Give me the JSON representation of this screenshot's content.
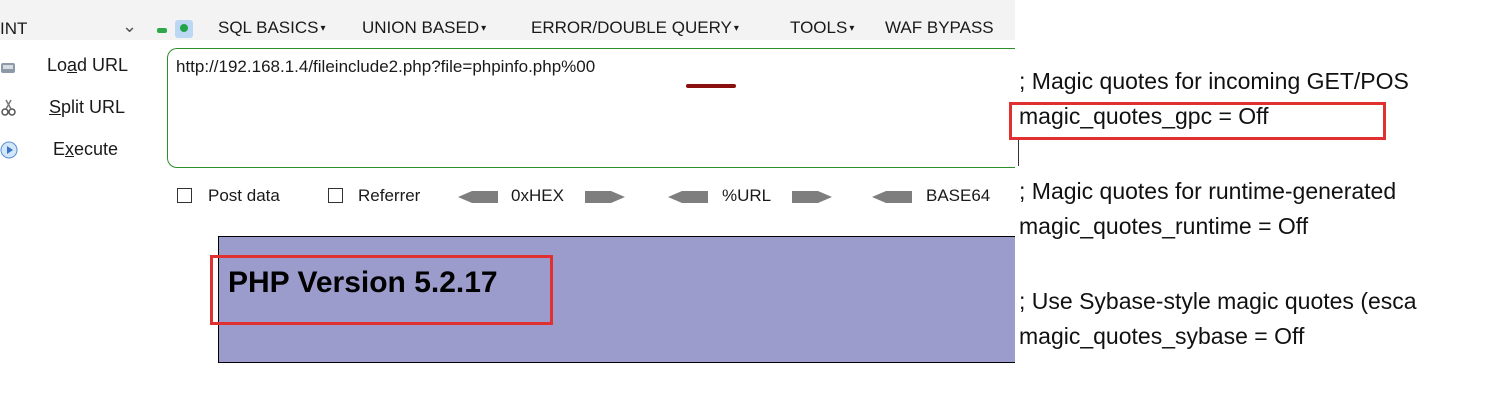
{
  "toolbar": {
    "selected": "INT",
    "menus": [
      "SQL BASICS",
      "UNION BASED",
      "ERROR/DOUBLE QUERY",
      "TOOLS",
      "WAF BYPASS"
    ],
    "menu_arrow": "▾"
  },
  "side_actions": [
    {
      "label": "Load URL",
      "accel": "a",
      "icon": "load-url-icon"
    },
    {
      "label": "Split URL",
      "accel": "S",
      "icon": "split-url-icon"
    },
    {
      "label": "Execute",
      "accel": "x",
      "icon": "execute-icon"
    }
  ],
  "url_value": "http://192.168.1.4/fileinclude2.php?file=phpinfo.php%00",
  "options": {
    "post_data": "Post data",
    "referrer": "Referrer",
    "hex": "0xHEX",
    "url": "%URL",
    "base64": "BASE64"
  },
  "php_version": "PHP Version 5.2.17",
  "ini_lines": [
    "; Magic quotes for incoming GET/POS",
    "magic_quotes_gpc = Off",
    "; Magic quotes for runtime-generated",
    "magic_quotes_runtime = Off",
    "; Use Sybase-style magic quotes (esca",
    "magic_quotes_sybase = Off"
  ],
  "colors": {
    "highlight_box": "#e03030",
    "url_underline": "#8a1010",
    "php_banner": "#9b9bcc",
    "url_border": "#2c8f2c"
  }
}
